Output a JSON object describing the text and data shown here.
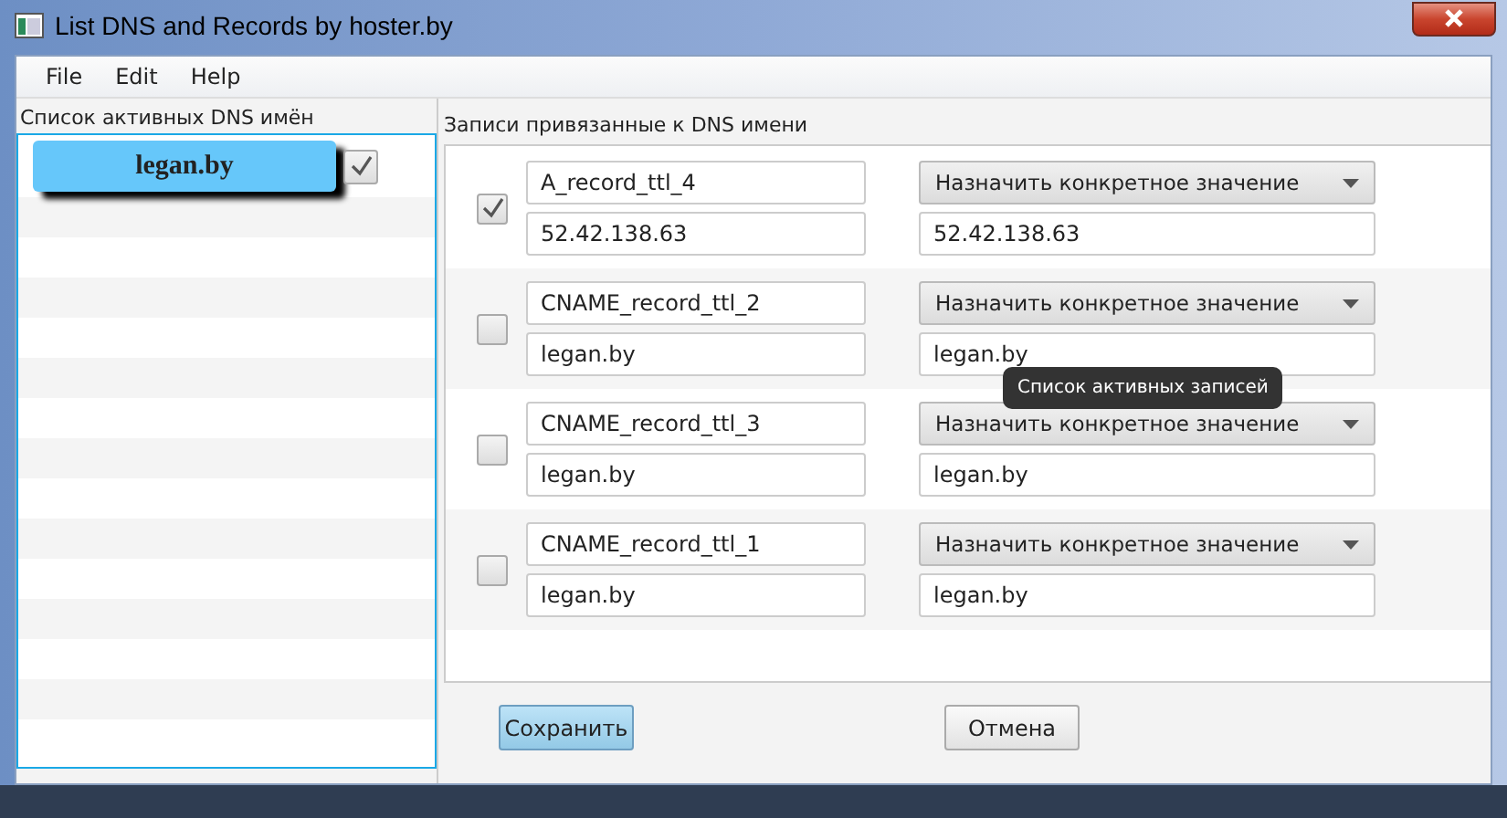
{
  "window": {
    "title": "List DNS and Records by hoster.by"
  },
  "menu": [
    "File",
    "Edit",
    "Help"
  ],
  "dns_list": {
    "title": "Список активных DNS имён",
    "items": [
      {
        "name": "legan.by",
        "checked": true
      }
    ]
  },
  "records": {
    "title": "Записи привязанные к DNS имени",
    "rows": [
      {
        "checked": true,
        "name": "A_record_ttl_4",
        "value": "52.42.138.63",
        "mode": "Назначить конкретное значение",
        "new_value": "52.42.138.63"
      },
      {
        "checked": false,
        "name": "CNAME_record_ttl_2",
        "value": "legan.by",
        "mode": "Назначить конкретное значение",
        "new_value": "legan.by"
      },
      {
        "checked": false,
        "name": "CNAME_record_ttl_3",
        "value": "legan.by",
        "mode": "Назначить конкретное значение",
        "new_value": "legan.by"
      },
      {
        "checked": false,
        "name": "CNAME_record_ttl_1",
        "value": "legan.by",
        "mode": "Назначить конкретное значение",
        "new_value": "legan.by"
      }
    ]
  },
  "tooltip": "Список активных записей",
  "buttons": [
    {
      "label": "Сохранить",
      "kind": "default"
    },
    {
      "label": "Отмена",
      "kind": "normal"
    }
  ]
}
